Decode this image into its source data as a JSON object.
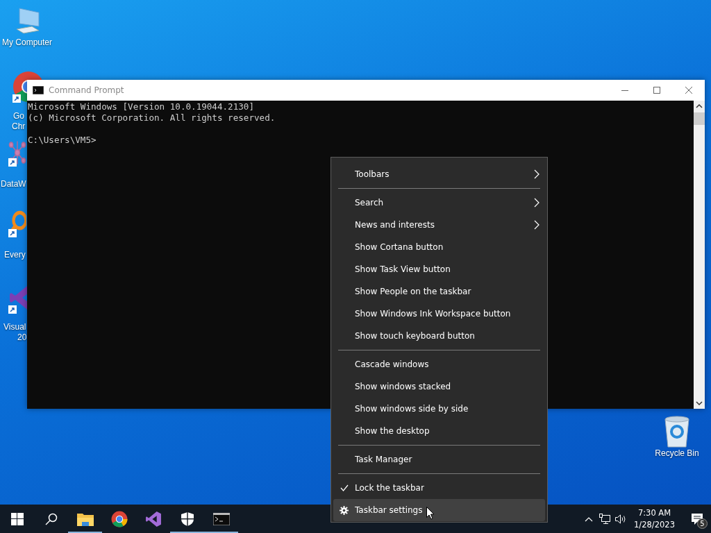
{
  "desktop_icons": [
    {
      "kind": "computer",
      "shortcut": false,
      "label_lines": [
        "My Computer"
      ]
    },
    {
      "kind": "browser",
      "shortcut": true,
      "label_lines": [
        "Go",
        "Chr"
      ]
    },
    {
      "kind": "molecule",
      "shortcut": true,
      "label_lines": [
        "DataW"
      ]
    },
    {
      "kind": "magnifier",
      "shortcut": true,
      "label_lines": [
        "Every"
      ]
    },
    {
      "kind": "studio",
      "shortcut": true,
      "label_lines": [
        "Visual",
        "20"
      ]
    },
    {
      "kind": "recycle",
      "shortcut": false,
      "label_lines": [
        "Recycle Bin"
      ]
    }
  ],
  "window": {
    "title": "Command Prompt",
    "output": [
      "Microsoft Windows [Version 10.0.19044.2130]",
      "(c) Microsoft Corporation. All rights reserved."
    ],
    "prompt": "C:\\Users\\VM5>"
  },
  "context_menu": {
    "groups": [
      [
        {
          "label": "Toolbars",
          "kind": "submenu",
          "selected": false
        }
      ],
      [
        {
          "label": "Search",
          "kind": "submenu",
          "selected": false
        },
        {
          "label": "News and interests",
          "kind": "submenu",
          "selected": false
        },
        {
          "label": "Show Cortana button",
          "kind": "plain",
          "selected": false
        },
        {
          "label": "Show Task View button",
          "kind": "plain",
          "selected": false
        },
        {
          "label": "Show People on the taskbar",
          "kind": "plain",
          "selected": false
        },
        {
          "label": "Show Windows Ink Workspace button",
          "kind": "plain",
          "selected": false
        },
        {
          "label": "Show touch keyboard button",
          "kind": "plain",
          "selected": false
        }
      ],
      [
        {
          "label": "Cascade windows",
          "kind": "plain",
          "selected": false
        },
        {
          "label": "Show windows stacked",
          "kind": "plain",
          "selected": false
        },
        {
          "label": "Show windows side by side",
          "kind": "plain",
          "selected": false
        },
        {
          "label": "Show the desktop",
          "kind": "plain",
          "selected": false
        }
      ],
      [
        {
          "label": "Task Manager",
          "kind": "plain",
          "selected": false
        }
      ],
      [
        {
          "label": "Lock the taskbar",
          "kind": "check",
          "checked": true,
          "selected": false
        },
        {
          "label": "Taskbar settings",
          "kind": "settings",
          "selected": true
        }
      ]
    ]
  },
  "taskbar": {
    "buttons": [
      {
        "kind": "start",
        "running": false
      },
      {
        "kind": "search",
        "running": false
      },
      {
        "kind": "folder",
        "running": true
      },
      {
        "kind": "browser",
        "running": false
      },
      {
        "kind": "studio",
        "running": false
      },
      {
        "kind": "shield",
        "running": true
      },
      {
        "kind": "terminal",
        "running": true
      }
    ],
    "clock": {
      "time": "7:30 AM",
      "date": "1/28/2023"
    },
    "notifications": {
      "count": "5"
    }
  }
}
